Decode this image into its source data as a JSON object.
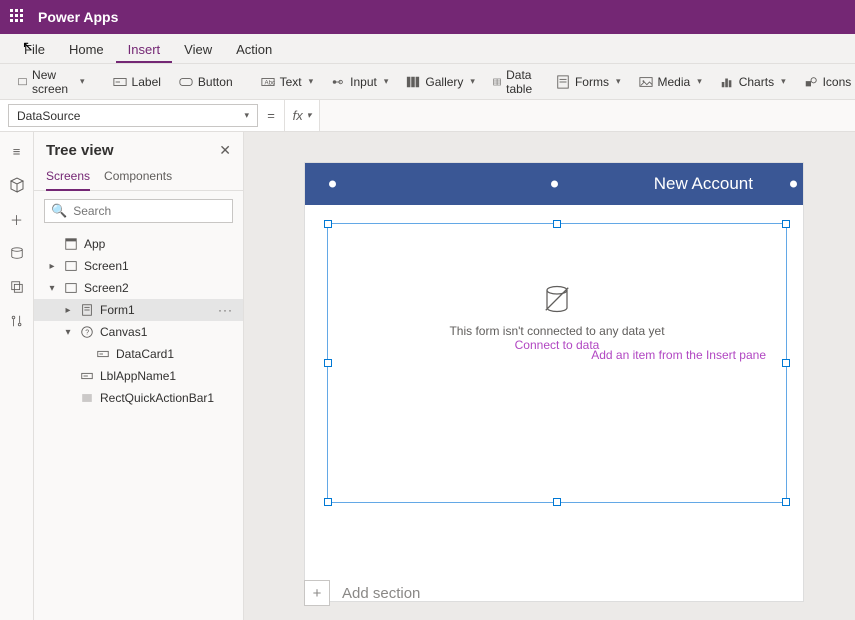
{
  "titlebar": {
    "app_name": "Power Apps"
  },
  "menubar": {
    "items": [
      "File",
      "Home",
      "Insert",
      "View",
      "Action"
    ],
    "active_index": 2
  },
  "toolbar": {
    "new_screen": "New screen",
    "label": "Label",
    "button": "Button",
    "text": "Text",
    "input": "Input",
    "gallery": "Gallery",
    "data_table": "Data table",
    "forms": "Forms",
    "media": "Media",
    "charts": "Charts",
    "icons": "Icons"
  },
  "formula_bar": {
    "property": "DataSource",
    "fx": "fx",
    "value": ""
  },
  "treeview": {
    "title": "Tree view",
    "tabs": [
      "Screens",
      "Components"
    ],
    "active_tab": 0,
    "search_placeholder": "Search",
    "nodes": [
      {
        "label": "App",
        "depth": 0,
        "icon": "app"
      },
      {
        "label": "Screen1",
        "depth": 0,
        "icon": "screen",
        "expand": "collapsed"
      },
      {
        "label": "Screen2",
        "depth": 0,
        "icon": "screen",
        "expand": "expanded"
      },
      {
        "label": "Form1",
        "depth": 1,
        "icon": "form",
        "selected": true,
        "more": true,
        "expand": "collapsed"
      },
      {
        "label": "Canvas1",
        "depth": 1,
        "icon": "canvas",
        "expand": "expanded",
        "unknown": true
      },
      {
        "label": "DataCard1",
        "depth": 2,
        "icon": "datacard"
      },
      {
        "label": "LblAppName1",
        "depth": 1,
        "icon": "label"
      },
      {
        "label": "RectQuickActionBar1",
        "depth": 1,
        "icon": "rect"
      }
    ]
  },
  "canvas": {
    "header_text": "New Account",
    "form_empty_msg": "This form isn't connected to any data yet",
    "connect_link": "Connect to data",
    "insert_hint": "Add an item from the Insert pane",
    "add_section": "Add section"
  }
}
